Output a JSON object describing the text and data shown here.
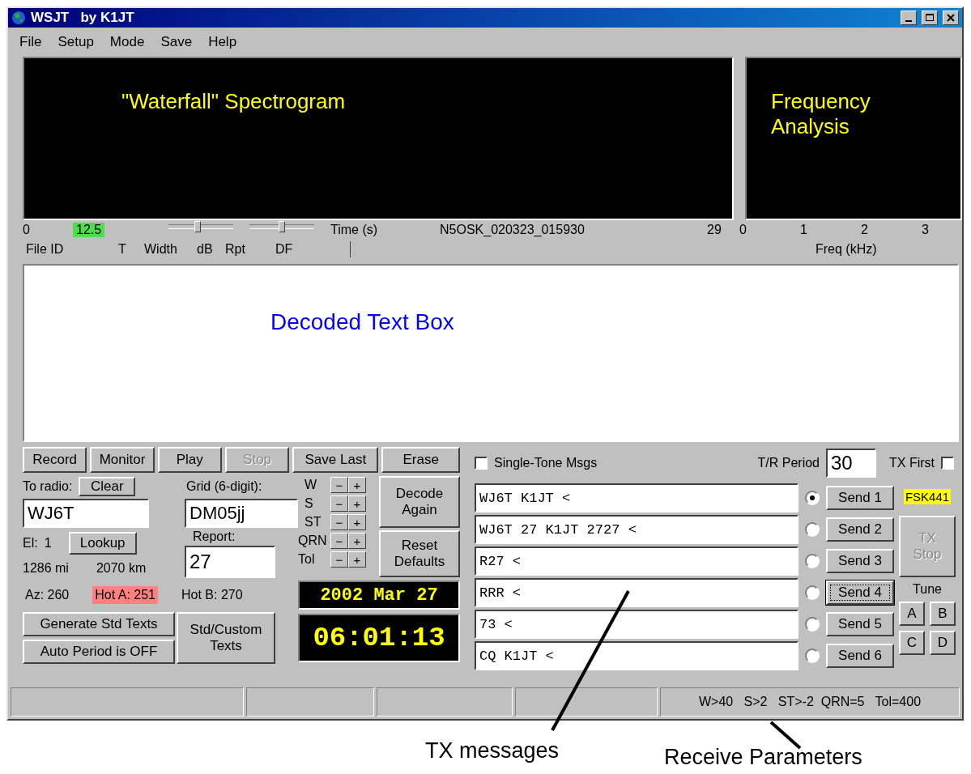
{
  "window": {
    "title": "WSJT   by K1JT"
  },
  "menu": [
    "File",
    "Setup",
    "Mode",
    "Save",
    "Help"
  ],
  "displays": {
    "waterfall_title": "\"Waterfall\" Spectrogram",
    "frequency_title": "Frequency Analysis"
  },
  "time_scale": {
    "start": "0",
    "t_value": "12.5",
    "label": "Time (s)",
    "file_name": "N5OSK_020323_015930",
    "end": "29"
  },
  "sliders": [
    {
      "level": 0.45
    },
    {
      "level": 0.5
    }
  ],
  "freq_scale": {
    "ticks": [
      "0",
      "1",
      "2",
      "3"
    ],
    "label": "Freq (kHz)"
  },
  "labels": [
    "File ID",
    "T",
    "Width",
    "dB",
    "Rpt",
    "DF"
  ],
  "decoded_text": {
    "caption": "Decoded Text Box"
  },
  "buttons": [
    {
      "label": "Record",
      "disabled": false
    },
    {
      "label": "Monitor",
      "disabled": false
    },
    {
      "label": "Play",
      "disabled": false
    },
    {
      "label": "Stop",
      "disabled": true
    },
    {
      "label": "Save Last",
      "disabled": false
    },
    {
      "label": "Erase",
      "disabled": false
    }
  ],
  "to_radio": {
    "label": "To radio:",
    "clear": "Clear",
    "value": "WJ6T"
  },
  "grid": {
    "label": "Grid (6-digit):",
    "value": "DM05jj"
  },
  "report": {
    "label": "Report:",
    "value": "27"
  },
  "elevation": {
    "label": "El:",
    "value": "1",
    "lookup": "Lookup"
  },
  "distance": [
    "1286 mi",
    "2070 km"
  ],
  "bearings": [
    {
      "text": "Az: 260",
      "highlighted": false
    },
    {
      "text": "Hot A: 251",
      "highlighted": true
    },
    {
      "text": "Hot B: 270",
      "highlighted": false
    }
  ],
  "adjust": [
    {
      "label": "W",
      "minus": "−",
      "plus": "+"
    },
    {
      "label": "S",
      "minus": "−",
      "plus": "+"
    },
    {
      "label": "ST",
      "minus": "−",
      "plus": "+"
    },
    {
      "label": "QRN",
      "minus": "−",
      "plus": "+"
    },
    {
      "label": "Tol",
      "minus": "−",
      "plus": "+"
    }
  ],
  "decode_again": "Decode Again",
  "reset_defaults": "Reset Defaults",
  "generate": "Generate Std Texts",
  "auto_period": "Auto Period is OFF",
  "std_custom": "Std/Custom Texts",
  "date": "2002 Mar 27",
  "time": "06:01:13",
  "single_tone": {
    "label": "Single-Tone Msgs",
    "checked": false
  },
  "tr_period": {
    "label": "T/R Period",
    "value": "30"
  },
  "tx_first": {
    "label": "TX First",
    "checked": false
  },
  "messages": [
    {
      "text": "WJ6T K1JT <",
      "selected": true,
      "send": "Send 1",
      "focused": false
    },
    {
      "text": "WJ6T 27 K1JT 2727 <",
      "selected": false,
      "send": "Send 2",
      "focused": false
    },
    {
      "text": "R27 <",
      "selected": false,
      "send": "Send 3",
      "focused": false
    },
    {
      "text": "RRR <",
      "selected": false,
      "send": "Send 4",
      "focused": true
    },
    {
      "text": "73 <",
      "selected": false,
      "send": "Send 5",
      "focused": false
    },
    {
      "text": "CQ K1JT <",
      "selected": false,
      "send": "Send 6",
      "focused": false
    }
  ],
  "mode_badge": "FSK441",
  "tx_stop": {
    "label": "TX Stop",
    "disabled": true
  },
  "tune": {
    "label": "Tune",
    "buttons": [
      "A",
      "B",
      "C",
      "D"
    ]
  },
  "receive_parameters": "W>40   S>2   ST>-2  QRN=5   Tol=400",
  "annotations": [
    "TX messages",
    "Receive Parameters"
  ]
}
